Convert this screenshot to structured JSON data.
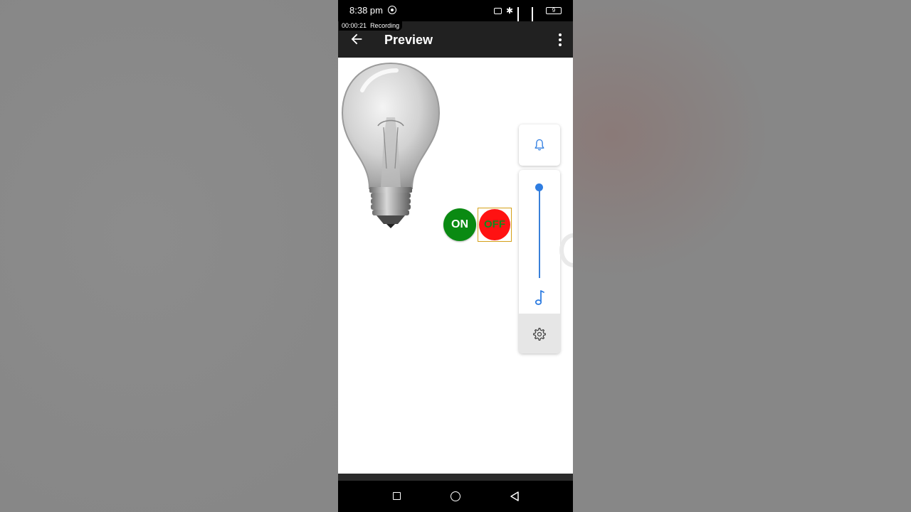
{
  "status_bar": {
    "time": "8:38 pm",
    "battery": "9"
  },
  "recording": {
    "elapsed": "00:00:21",
    "label": "Recording"
  },
  "app_bar": {
    "title": "Preview"
  },
  "canvas": {
    "on_button_label": "ON",
    "off_button_label": "OFF",
    "on_color": "#0a8a12",
    "off_color": "#ff1212"
  },
  "volume_panel": {
    "accent": "#2f7de1",
    "level": 1.0,
    "icons": [
      "bell-icon",
      "music-note-icon",
      "gear-icon"
    ]
  }
}
